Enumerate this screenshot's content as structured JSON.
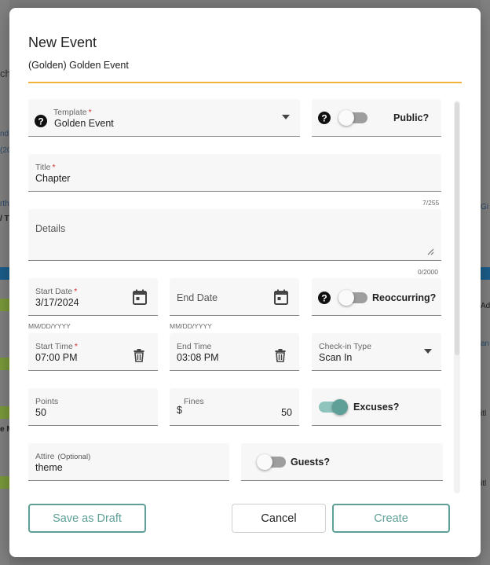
{
  "background": {
    "fragments": [
      "ch",
      "nd",
      "(20",
      "rth",
      "/ T",
      "Gi",
      "Adv",
      "an",
      "Gi",
      "itl",
      "e M",
      "itl"
    ]
  },
  "modal": {
    "title": "New Event",
    "subtitle": "(Golden) Golden Event"
  },
  "form": {
    "template": {
      "label": "Template",
      "value": "Golden Event"
    },
    "public": {
      "label": "Public?",
      "on": false
    },
    "title": {
      "label": "Title",
      "value": "Chapter",
      "counter": "7/255"
    },
    "details": {
      "placeholder": "Details",
      "counter": "0/2000"
    },
    "start_date": {
      "label": "Start Date",
      "value": "3/17/2024",
      "hint": "MM/DD/YYYY"
    },
    "end_date": {
      "placeholder": "End Date",
      "hint": "MM/DD/YYYY"
    },
    "reoccurring": {
      "label": "Reoccurring?",
      "on": false
    },
    "start_time": {
      "label": "Start Time",
      "value": "07:00 PM"
    },
    "end_time": {
      "label": "End Time",
      "value": "03:08 PM"
    },
    "checkin_type": {
      "label": "Check-in Type",
      "value": "Scan In"
    },
    "points": {
      "label": "Points",
      "value": "50"
    },
    "fines": {
      "label": "Fines",
      "prefix": "$",
      "value": "50"
    },
    "excuses": {
      "label": "Excuses?",
      "on": true
    },
    "attire": {
      "label": "Attire",
      "optional": "(Optional)",
      "value": "theme"
    },
    "guests": {
      "label": "Guests?",
      "on": false
    },
    "required_mark": "*"
  },
  "buttons": {
    "save_draft": "Save as Draft",
    "cancel": "Cancel",
    "create": "Create"
  },
  "colors": {
    "accent": "#5e9f97",
    "header_rule": "#f2b33d",
    "required": "#d32f2f"
  }
}
